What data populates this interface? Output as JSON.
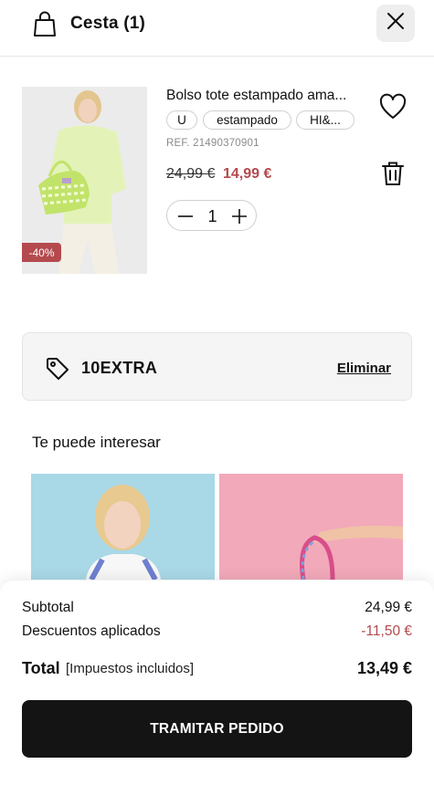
{
  "header": {
    "title": "Cesta (1)",
    "bag_icon": "shopping-bag-icon",
    "close_icon": "close-icon"
  },
  "product": {
    "name": "Bolso tote estampado ama...",
    "tags": [
      "U",
      "estampado",
      "HI&..."
    ],
    "ref": "REF. 21490370901",
    "old_price": "24,99 €",
    "new_price": "14,99 €",
    "discount": "-40%",
    "quantity": "1",
    "heart_icon": "heart-icon",
    "trash_icon": "trash-icon"
  },
  "coupon": {
    "code": "10EXTRA",
    "remove_label": "Eliminar",
    "icon": "tag-icon"
  },
  "recommendations": {
    "title": "Te puede interesar"
  },
  "summary": {
    "subtotal_label": "Subtotal",
    "subtotal_value": "24,99 €",
    "discounts_label": "Descuentos aplicados",
    "discounts_value": "-11,50 €",
    "total_label": "Total",
    "total_note": "[Impuestos incluidos]",
    "total_value": "13,49 €",
    "checkout_label": "TRAMITAR PEDIDO"
  },
  "colors": {
    "accent_red": "#b44a4e",
    "button_dark": "#141414",
    "coupon_bg": "#f5f5f5"
  }
}
